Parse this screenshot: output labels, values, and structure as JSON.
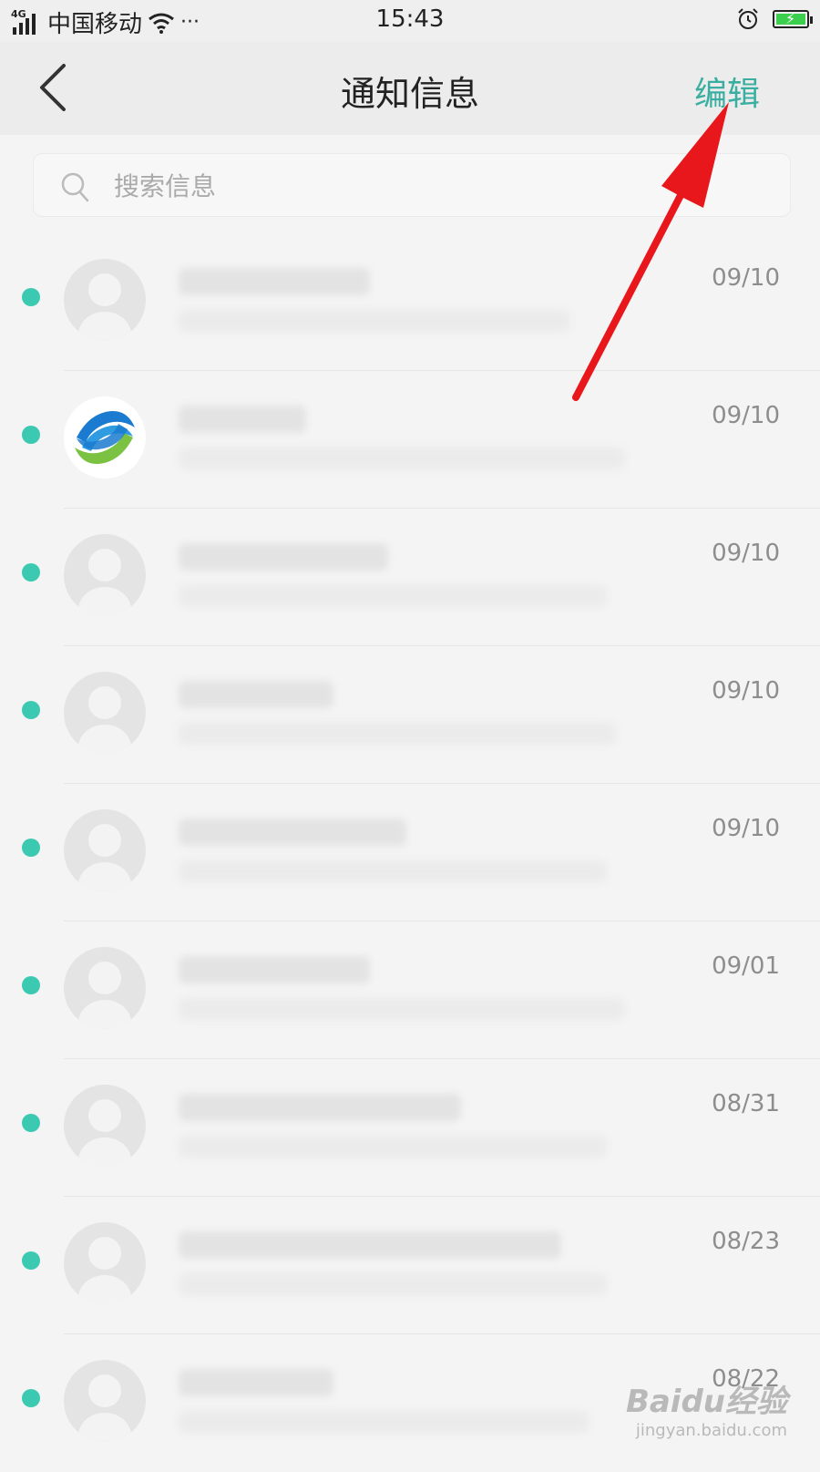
{
  "status_bar": {
    "network": "4G",
    "carrier": "中国移动",
    "more": "···",
    "time": "15:43"
  },
  "header": {
    "title": "通知信息",
    "edit_label": "编辑",
    "back_icon": "chevron-left-icon"
  },
  "search": {
    "placeholder": "搜索信息",
    "icon": "search-icon"
  },
  "messages": [
    {
      "date": "09/10",
      "unread": true,
      "avatar": "default"
    },
    {
      "date": "09/10",
      "unread": true,
      "avatar": "china-mobile-logo"
    },
    {
      "date": "09/10",
      "unread": true,
      "avatar": "default"
    },
    {
      "date": "09/10",
      "unread": true,
      "avatar": "default"
    },
    {
      "date": "09/10",
      "unread": true,
      "avatar": "default"
    },
    {
      "date": "09/01",
      "unread": true,
      "avatar": "default"
    },
    {
      "date": "08/31",
      "unread": true,
      "avatar": "default"
    },
    {
      "date": "08/23",
      "unread": true,
      "avatar": "default"
    },
    {
      "date": "08/22",
      "unread": true,
      "avatar": "default"
    }
  ],
  "colors": {
    "accent": "#3aaea0",
    "unread_dot": "#3cc9b1",
    "arrow": "#e8171c"
  },
  "watermark": {
    "main": "Baidu经验",
    "sub": "jingyan.baidu.com"
  }
}
